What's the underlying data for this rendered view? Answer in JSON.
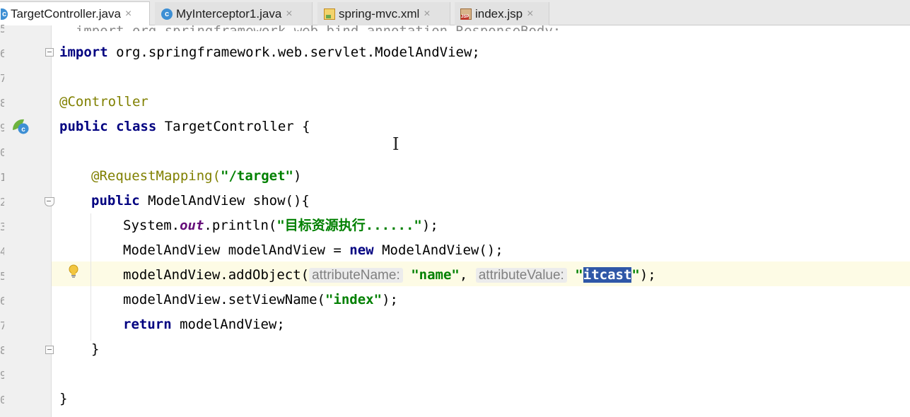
{
  "tabs": [
    {
      "label": "TargetController.java",
      "icon": "java-class-icon",
      "active": true
    },
    {
      "label": "MyInterceptor1.java",
      "icon": "java-class-icon",
      "active": false
    },
    {
      "label": "spring-mvc.xml",
      "icon": "xml-file-icon",
      "active": false
    },
    {
      "label": "index.jsp",
      "icon": "jsp-file-icon",
      "active": false
    }
  ],
  "tab_close_glyph": "×",
  "gutter": {
    "line_numbers": [
      "5",
      "6",
      "7",
      "8",
      "9",
      "0",
      "1",
      "2",
      "3",
      "4",
      "5",
      "6",
      "7",
      "8",
      "9",
      "0"
    ]
  },
  "code": {
    "line_partial_top": "import org.springframework.web.bind.annotation.ResponseBody;",
    "import_kw": "import",
    "import_rest": " org.springframework.web.servlet.ModelAndView;",
    "controller_ann": "@Controller",
    "class_kw": "public class",
    "class_rest": " TargetController {",
    "mapping_ann": "@RequestMapping(",
    "mapping_str": "\"/target\"",
    "mapping_close": ")",
    "method_kw": "public",
    "method_rest": " ModelAndView show(){",
    "println_pre": "System.",
    "println_out": "out",
    "println_mid": ".println(",
    "println_str": "\"目标资源执行......\"",
    "println_end": ");",
    "mav_pre": "ModelAndView modelAndView = ",
    "mav_new": "new",
    "mav_post": " ModelAndView();",
    "add_pre": "modelAndView.addObject(",
    "add_hint1": "attributeName:",
    "add_str1": "\"name\"",
    "add_comma": ", ",
    "add_hint2": "attributeValue:",
    "add_quote_open": "\"",
    "add_selected": "itcast",
    "add_quote_close": "\"",
    "add_end": ");",
    "setview_pre": "modelAndView.setViewName(",
    "setview_str": "\"index\"",
    "setview_end": ");",
    "return_kw": "return",
    "return_rest": " modelAndView;",
    "method_close": "}",
    "class_close": "}"
  },
  "colors": {
    "keyword": "#000080",
    "annotation": "#808000",
    "string": "#008000",
    "static_field": "#660e7a",
    "selection": "#2f57a7",
    "current_line": "#fdfbe5"
  }
}
